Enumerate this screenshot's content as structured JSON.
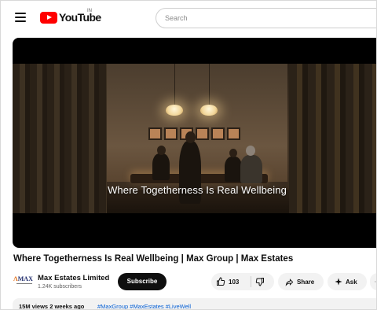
{
  "header": {
    "logo_text": "YouTube",
    "region_code": "IN",
    "search_placeholder": "Search"
  },
  "video": {
    "caption": "Where Togetherness Is Real Wellbeing",
    "title": "Where Togetherness Is Real Wellbeing | Max Group | Max Estates"
  },
  "channel": {
    "logo_text_part1": "MAX",
    "name": "Max Estates Limited",
    "subscribers": "1.24K subscribers",
    "subscribe_label": "Subscribe"
  },
  "actions": {
    "like_count": "103",
    "share_label": "Share",
    "ask_label": "Ask"
  },
  "description": {
    "views_date": "15M views  2 weeks ago",
    "hashtags": "#MaxGroup #MaxEstates #LiveWell"
  },
  "colors": {
    "brand_red": "#ff0000",
    "link_blue": "#065fd4",
    "subscribe_bg": "#0f0f0f"
  }
}
